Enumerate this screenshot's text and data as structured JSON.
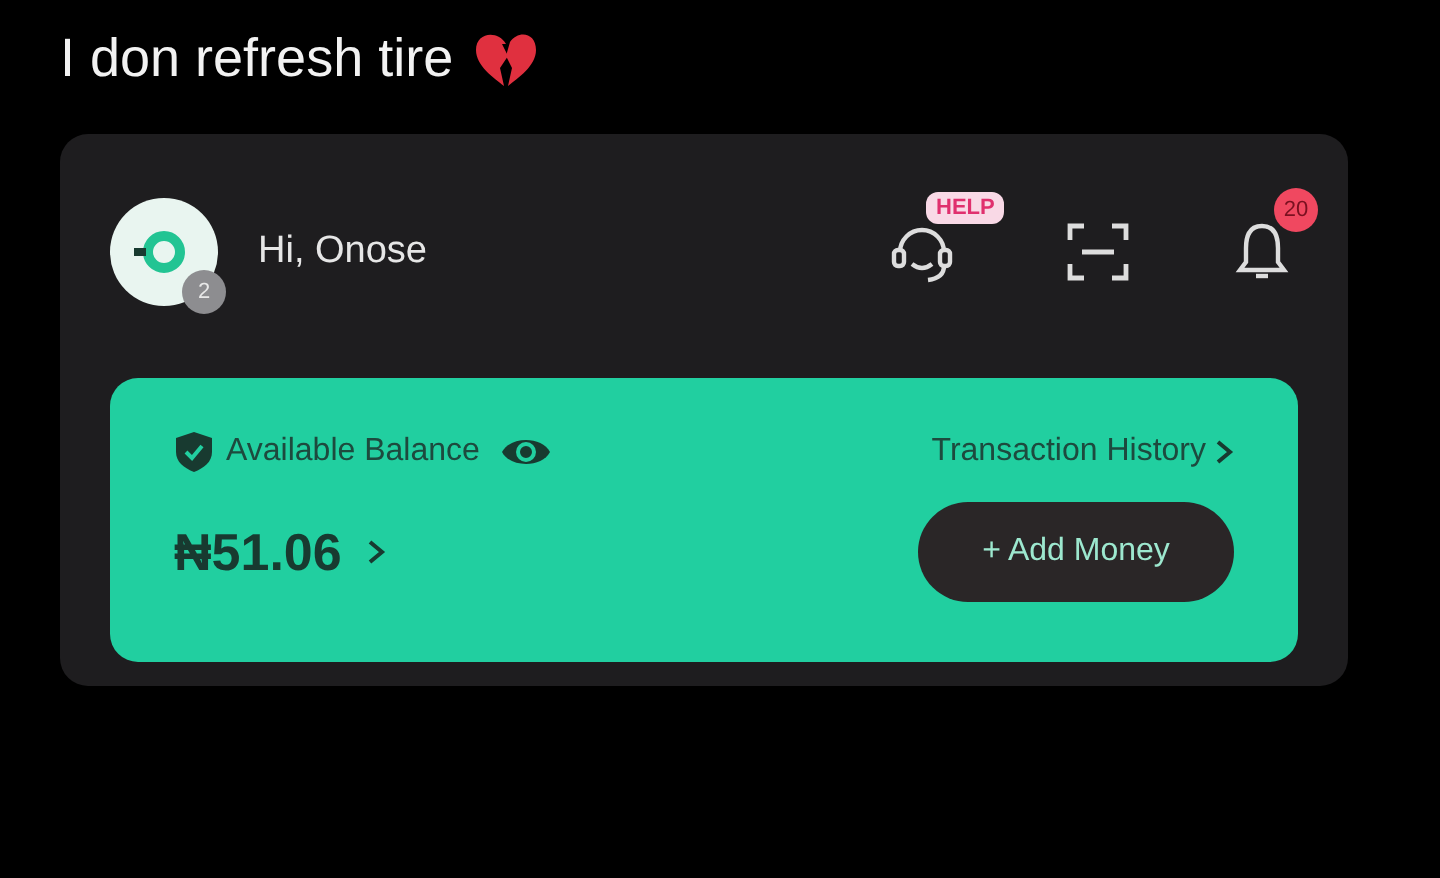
{
  "post": {
    "caption": "I don refresh tire"
  },
  "header": {
    "greeting": "Hi, Onose",
    "avatar_badge": "2",
    "help_badge": "HELP",
    "notification_count": "20"
  },
  "balance": {
    "label": "Available Balance",
    "link": "Transaction History",
    "amount": "₦51.06",
    "button": "+ Add Money"
  }
}
